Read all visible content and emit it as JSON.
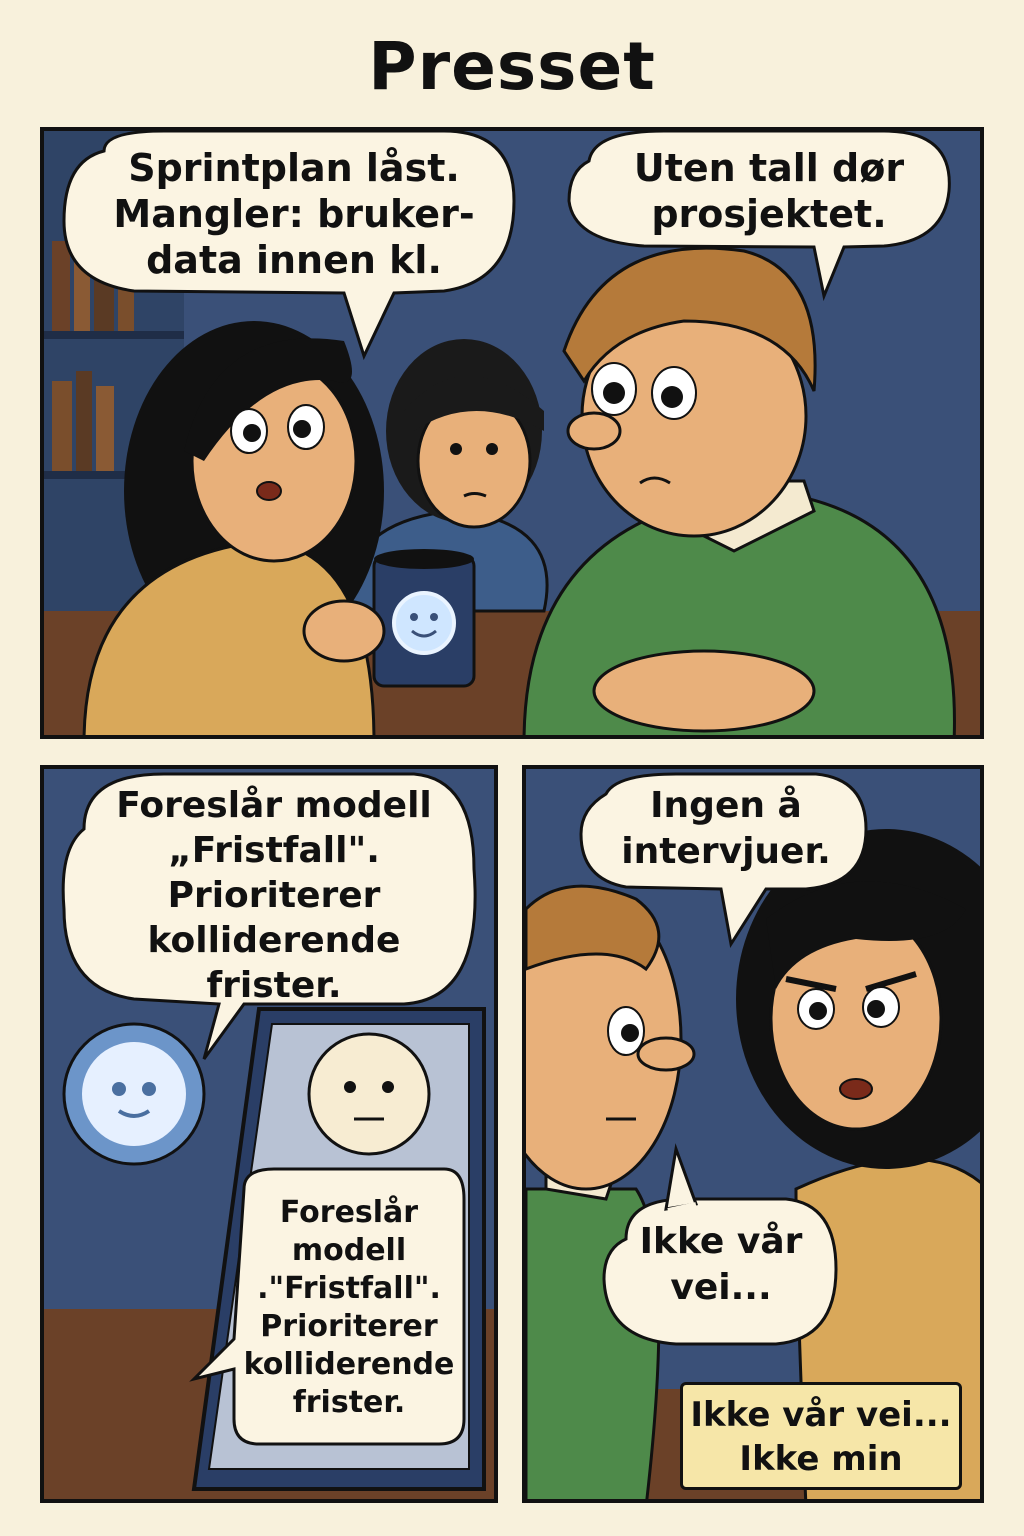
{
  "title": "Presset",
  "panel1": {
    "bubble_left": "Sprintplan låst.\nMangler: bruker-\ndata innen kl.",
    "bubble_right": "Uten tall dør\nprosjektet."
  },
  "panel2": {
    "bubble": "Foreslår modell\n„Fristfall\".\nPrioriterer\nkolliderende\nfrister.",
    "screen_text": "Foreslår\nmodell\n.\"Fristfall\".\nPrioriterer\nkolliderende\nfrister."
  },
  "panel3": {
    "bubble_top": "Ingen å\nintervjuer.",
    "bubble_bottom": "Ikke vår\nvei...",
    "caption": "Ikke vår vei...\nIkke min"
  },
  "colors": {
    "background": "#f8f1dc",
    "panel_bg": "#3a5078",
    "sweater_yellow": "#d9a85a",
    "sweater_green": "#4e8a4a",
    "table": "#6b4128",
    "caption_bg": "#f6e6a8"
  }
}
